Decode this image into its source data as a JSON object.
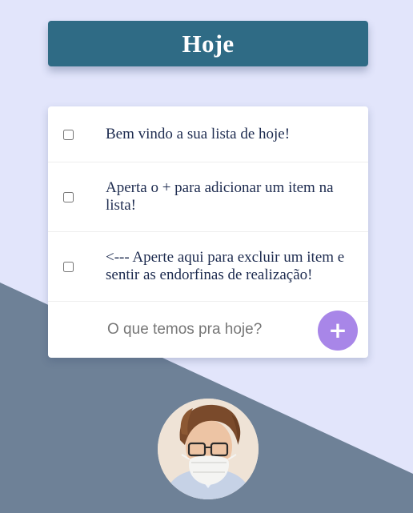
{
  "header": {
    "title": "Hoje"
  },
  "todo": {
    "items": [
      {
        "label": "Bem vindo a sua lista de hoje!",
        "checked": false
      },
      {
        "label": "Aperta o + para adicionar um item na lista!",
        "checked": false
      },
      {
        "label": "<--- Aperte aqui para excluir um item e sentir as endorfinas de realização!",
        "checked": false
      }
    ],
    "input_placeholder": "O que temos pra hoje?",
    "input_value": "",
    "add_button_label": "+"
  },
  "colors": {
    "background_light": "#e2e5fb",
    "background_dark": "#6e8197",
    "header": "#2f6b85",
    "add_button": "#a886e8",
    "item_text": "#1d2b4f"
  },
  "icons": {
    "add": "plus-icon",
    "avatar": "user-avatar-photo"
  }
}
